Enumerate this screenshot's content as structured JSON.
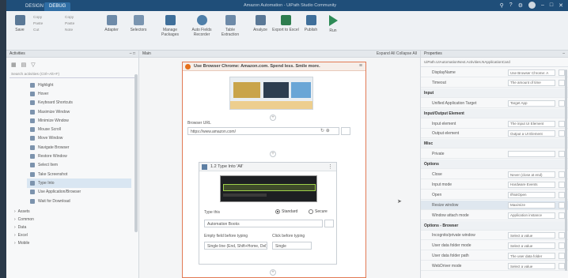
{
  "titlebar": {
    "tabs": [
      "DESIGN",
      "DEBUG"
    ],
    "center_text": "Amazon Automation - UiPath Studio Community"
  },
  "ribbon": {
    "buttons": [
      {
        "label": "Save"
      },
      {
        "label": "Adapter"
      },
      {
        "label": "Selectors"
      },
      {
        "label": "Manage Packages"
      },
      {
        "label": "Auto Fields Recorder"
      },
      {
        "label": "Table Extraction"
      },
      {
        "label": "Analyze"
      },
      {
        "label": "Export to Excel"
      },
      {
        "label": "Publish"
      },
      {
        "label": "Run"
      }
    ],
    "small_items": [
      "Copy",
      "Paste",
      "Cut",
      "Copy",
      "Paste",
      "Note"
    ]
  },
  "activities": {
    "header": "Activities",
    "search_placeholder": "Search activities (Ctrl+Alt+F)",
    "items": [
      "Highlight",
      "Hover",
      "Keyboard Shortcuts",
      "Maximize Window",
      "Minimize Window",
      "Mouse Scroll",
      "Move Window",
      "Navigate Browser",
      "Restore Window",
      "Select Item",
      "Take Screenshot",
      "Type Into",
      "Use Application/Browser",
      "Wait for Download"
    ],
    "selected_index": 11,
    "categories": [
      "Assets",
      "Common",
      "Data",
      "Excel",
      "Mobile"
    ]
  },
  "main": {
    "header": "Main",
    "header_right": "Expand All   Collapse All",
    "sequence_title": "Use Browser Chrome: Amazon.com. Spend less. Smile more.",
    "browser_url_label": "Browser URL",
    "browser_url_value": "https://www.amazon.com/",
    "type_into": {
      "title": "1.2  Type Into 'All'",
      "type_this_label": "Type this",
      "type_this_value": "Automation Books",
      "radio_standard": "Standard",
      "radio_secure": "Secure",
      "empty_field_label": "Empty field before typing",
      "empty_field_value": "Single line (End, Shift+Home, Del)",
      "click_before_label": "Click before typing",
      "click_before_value": "Single"
    }
  },
  "properties": {
    "header": "Properties",
    "path": "UiPath.UIAutomationNext.Activities.NApplicationCard",
    "rows": [
      {
        "name": "DisplayName",
        "value": "Use Browser Chrome: A"
      },
      {
        "name": "Timeout",
        "value": "The amount of time"
      },
      {
        "name": "Input",
        "value": "",
        "section": true
      },
      {
        "name": "Unified Application Target",
        "value": "Target App"
      },
      {
        "name": "Input/Output Element",
        "value": "",
        "section": true
      },
      {
        "name": "Input element",
        "value": "The input UI Element"
      },
      {
        "name": "Output element",
        "value": "Output a UI Element"
      },
      {
        "name": "Misc",
        "value": "",
        "section": true
      },
      {
        "name": "Private",
        "value": ""
      },
      {
        "name": "Options",
        "value": "",
        "section": true
      },
      {
        "name": "Close",
        "value": "Never (close at end)"
      },
      {
        "name": "Input mode",
        "value": "Hardware Events"
      },
      {
        "name": "Open",
        "value": "IfNotOpen"
      },
      {
        "name": "Resize window",
        "value": "Maximize",
        "highlight": true
      },
      {
        "name": "Window attach mode",
        "value": "Application instance"
      },
      {
        "name": "Options - Browser",
        "value": "",
        "section": true
      },
      {
        "name": "Incognito/private window",
        "value": "Select a value"
      },
      {
        "name": "User data folder mode",
        "value": "Select a value"
      },
      {
        "name": "User data folder path",
        "value": "The user data folder"
      },
      {
        "name": "WebDriver mode",
        "value": "Select a value"
      }
    ]
  },
  "colors": {
    "titlebar": "#1f4e79",
    "accent_orange": "#e27a55",
    "selection": "#d9e6f2"
  }
}
